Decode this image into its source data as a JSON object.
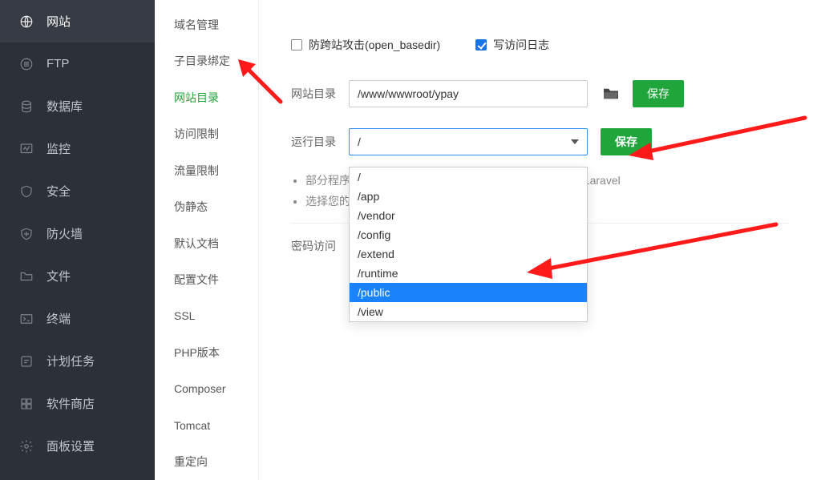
{
  "sidebar": {
    "items": [
      {
        "label": "网站",
        "icon": "globe-icon",
        "active": true
      },
      {
        "label": "FTP",
        "icon": "ftp-icon"
      },
      {
        "label": "数据库",
        "icon": "database-icon"
      },
      {
        "label": "监控",
        "icon": "monitor-icon"
      },
      {
        "label": "安全",
        "icon": "shield-icon"
      },
      {
        "label": "防火墙",
        "icon": "wall-icon"
      },
      {
        "label": "文件",
        "icon": "folder-icon"
      },
      {
        "label": "终端",
        "icon": "terminal-icon"
      },
      {
        "label": "计划任务",
        "icon": "task-icon"
      },
      {
        "label": "软件商店",
        "icon": "store-icon"
      },
      {
        "label": "面板设置",
        "icon": "settings-icon"
      }
    ]
  },
  "settings": {
    "items": [
      "域名管理",
      "子目录绑定",
      "网站目录",
      "访问限制",
      "流量限制",
      "伪静态",
      "默认文档",
      "配置文件",
      "SSL",
      "PHP版本",
      "Composer",
      "Tomcat",
      "重定向"
    ],
    "active": "网站目录"
  },
  "content": {
    "chk_open_basedir": {
      "label": "防跨站攻击(open_basedir)",
      "checked": false
    },
    "chk_access_log": {
      "label": "写访问日志",
      "checked": true
    },
    "site_dir": {
      "label": "网站目录",
      "value": "/www/wwwroot/ypay",
      "save": "保存"
    },
    "run_dir": {
      "label": "运行目录",
      "value": "/",
      "save": "保存",
      "options": [
        "/",
        "/app",
        "/vendor",
        "/config",
        "/extend",
        "/runtime",
        "/public",
        "/view"
      ],
      "highlight": "/public"
    },
    "tips": {
      "line1_prefix": "部分程序",
      "line1_suffix": "HP5, Laravel",
      "line2": "选择您的"
    },
    "password_section": "密码访问"
  },
  "colors": {
    "accent_green": "#20a53a",
    "accent_blue": "#1a82fb",
    "sidebar": "#2c3037"
  }
}
